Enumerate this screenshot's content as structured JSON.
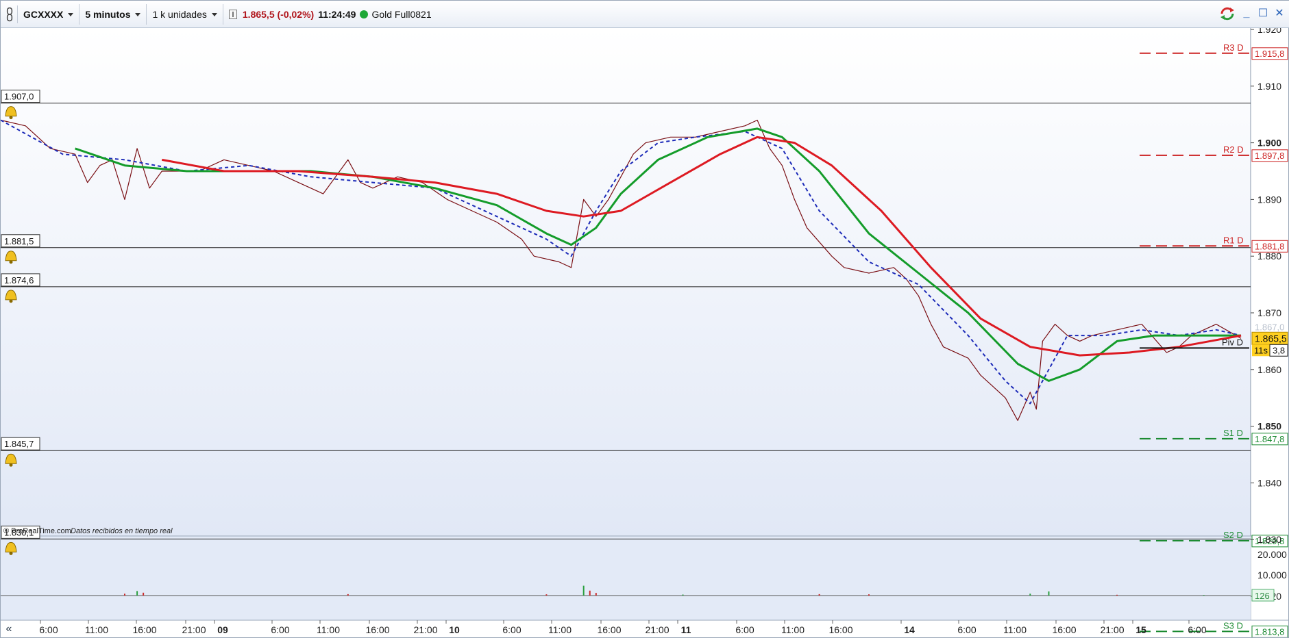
{
  "toolbar": {
    "symbol": "GCXXXX",
    "timeframe": "5 minutos",
    "units": "1 k unidades",
    "price_change": "1.865,5 (-0,02%)",
    "clock": "11:24:49",
    "instrument": "Gold Full0821"
  },
  "colors": {
    "price_line": "#7a0f14",
    "ma_red": "#dd1a22",
    "ma_green": "#149c2a",
    "ma_dashed": "#1c2ab8",
    "resistance": "#cc2222",
    "support": "#1a8a30",
    "price_tag": "#ffd020"
  },
  "horizontal_levels": [
    {
      "label": "1.907,0",
      "value": 1907.0
    },
    {
      "label": "1.881,5",
      "value": 1881.5
    },
    {
      "label": "1.874,6",
      "value": 1874.6
    },
    {
      "label": "1.845,7",
      "value": 1845.7
    },
    {
      "label": "1.830,1",
      "value": 1830.1
    }
  ],
  "pivots": [
    {
      "name": "R3 D",
      "value": 1915.8,
      "label": "1.915,8",
      "kind": "resistance"
    },
    {
      "name": "R2 D",
      "value": 1897.8,
      "label": "1.897,8",
      "kind": "resistance"
    },
    {
      "name": "R1 D",
      "value": 1881.8,
      "label": "1.881,8",
      "kind": "resistance"
    },
    {
      "name": "S1 D",
      "value": 1847.8,
      "label": "1.847,8",
      "kind": "support"
    },
    {
      "name": "S2 D",
      "value": 1829.8,
      "label": "1.829,8",
      "kind": "support"
    },
    {
      "name": "S3 D",
      "value": 1813.8,
      "label": "1.813,8",
      "kind": "support"
    }
  ],
  "pivot_point": {
    "name": "Piv D",
    "value": 1863.8,
    "label": "3,8"
  },
  "current_price": {
    "value": 1865.5,
    "label": "1.865,5"
  },
  "countdown": "11s",
  "faded_price_label": "1.867,0",
  "price_axis": [
    {
      "v": 1920,
      "label": "1.920",
      "bold": false
    },
    {
      "v": 1910,
      "label": "1.910",
      "bold": false
    },
    {
      "v": 1900,
      "label": "1.900",
      "bold": true
    },
    {
      "v": 1890,
      "label": "1.890",
      "bold": false
    },
    {
      "v": 1880,
      "label": "1.880",
      "bold": false
    },
    {
      "v": 1870,
      "label": "1.870",
      "bold": false
    },
    {
      "v": 1860,
      "label": "1.860",
      "bold": false
    },
    {
      "v": 1850,
      "label": "1.850",
      "bold": true
    },
    {
      "v": 1840,
      "label": "1.840",
      "bold": false
    },
    {
      "v": 1830,
      "label": "1.830",
      "bold": false
    },
    {
      "v": 1820,
      "label": "1.820",
      "bold": false
    }
  ],
  "volume_axis": [
    {
      "label": "20.000"
    },
    {
      "label": "10.000"
    }
  ],
  "volume_current": "126",
  "watermark": {
    "brand": "© ProRealTime.com",
    "status": "Datos recibidos en tiempo real"
  },
  "time_axis": [
    "6:00",
    "11:00",
    "16:00",
    "21:00",
    "09",
    "6:00",
    "11:00",
    "16:00",
    "21:00",
    "10",
    "6:00",
    "11:00",
    "16:00",
    "21:00",
    "11",
    "6:00",
    "11:00",
    "16:00",
    "14",
    "6:00",
    "11:00",
    "16:00",
    "21:00",
    "15",
    "6:00"
  ],
  "time_axis_bold": [
    "09",
    "10",
    "11",
    "14",
    "15"
  ],
  "collapse_label": "«",
  "chart_data": {
    "type": "line",
    "ylim": [
      1808,
      1924
    ],
    "x_index_range": [
      0,
      100
    ],
    "day_separators_x": [
      17,
      36,
      55,
      73,
      91
    ],
    "series": [
      {
        "role": "price",
        "points": [
          [
            0,
            1904
          ],
          [
            2,
            1903
          ],
          [
            4,
            1899
          ],
          [
            6,
            1898
          ],
          [
            7,
            1893
          ],
          [
            8,
            1896
          ],
          [
            9,
            1897
          ],
          [
            10,
            1890
          ],
          [
            11,
            1899
          ],
          [
            12,
            1892
          ],
          [
            13,
            1895
          ],
          [
            14,
            1895
          ],
          [
            16,
            1895
          ],
          [
            18,
            1897
          ],
          [
            20,
            1896
          ],
          [
            22,
            1895
          ],
          [
            24,
            1893
          ],
          [
            26,
            1891
          ],
          [
            28,
            1897
          ],
          [
            29,
            1893
          ],
          [
            30,
            1892
          ],
          [
            32,
            1894
          ],
          [
            34,
            1893
          ],
          [
            36,
            1890
          ],
          [
            38,
            1888
          ],
          [
            40,
            1886
          ],
          [
            42,
            1883
          ],
          [
            43,
            1880
          ],
          [
            45,
            1879
          ],
          [
            46,
            1878
          ],
          [
            47,
            1890
          ],
          [
            48,
            1887
          ],
          [
            49,
            1890
          ],
          [
            50,
            1894
          ],
          [
            51,
            1898
          ],
          [
            52,
            1900
          ],
          [
            54,
            1901
          ],
          [
            56,
            1901
          ],
          [
            58,
            1902
          ],
          [
            60,
            1903
          ],
          [
            61,
            1904
          ],
          [
            62,
            1899
          ],
          [
            63,
            1896
          ],
          [
            64,
            1890
          ],
          [
            65,
            1885
          ],
          [
            67,
            1880
          ],
          [
            68,
            1878
          ],
          [
            70,
            1877
          ],
          [
            72,
            1878
          ],
          [
            73,
            1876
          ],
          [
            74,
            1873
          ],
          [
            75,
            1868
          ],
          [
            76,
            1864
          ],
          [
            78,
            1862
          ],
          [
            79,
            1859
          ],
          [
            80,
            1857
          ],
          [
            81,
            1855
          ],
          [
            82,
            1851
          ],
          [
            83,
            1856
          ],
          [
            83.5,
            1853
          ],
          [
            84,
            1865
          ],
          [
            85,
            1868
          ],
          [
            86,
            1866
          ],
          [
            87,
            1865
          ],
          [
            88,
            1866
          ],
          [
            90,
            1867
          ],
          [
            92,
            1868
          ],
          [
            94,
            1863
          ],
          [
            95,
            1864
          ],
          [
            96,
            1866
          ],
          [
            98,
            1868
          ],
          [
            100,
            1865.5
          ]
        ]
      },
      {
        "role": "ma_dashed",
        "points": [
          [
            0,
            1904
          ],
          [
            5,
            1898
          ],
          [
            10,
            1897
          ],
          [
            15,
            1895
          ],
          [
            20,
            1896
          ],
          [
            25,
            1894
          ],
          [
            30,
            1893
          ],
          [
            35,
            1892
          ],
          [
            40,
            1887
          ],
          [
            44,
            1883
          ],
          [
            46,
            1880
          ],
          [
            48,
            1888
          ],
          [
            50,
            1895
          ],
          [
            53,
            1900
          ],
          [
            56,
            1901
          ],
          [
            60,
            1902
          ],
          [
            63,
            1899
          ],
          [
            66,
            1888
          ],
          [
            70,
            1879
          ],
          [
            74,
            1875
          ],
          [
            78,
            1866
          ],
          [
            81,
            1858
          ],
          [
            83,
            1854
          ],
          [
            84.5,
            1860
          ],
          [
            86,
            1866
          ],
          [
            89,
            1866
          ],
          [
            92,
            1867
          ],
          [
            95,
            1866
          ],
          [
            98,
            1867
          ],
          [
            100,
            1866
          ]
        ]
      },
      {
        "role": "ma_green",
        "points": [
          [
            6,
            1899
          ],
          [
            10,
            1896
          ],
          [
            15,
            1895
          ],
          [
            20,
            1895
          ],
          [
            25,
            1895
          ],
          [
            30,
            1894
          ],
          [
            35,
            1892
          ],
          [
            40,
            1889
          ],
          [
            44,
            1884
          ],
          [
            46,
            1882
          ],
          [
            48,
            1885
          ],
          [
            50,
            1891
          ],
          [
            53,
            1897
          ],
          [
            57,
            1901
          ],
          [
            61,
            1902.5
          ],
          [
            63,
            1901
          ],
          [
            66,
            1895
          ],
          [
            70,
            1884
          ],
          [
            74,
            1877
          ],
          [
            78,
            1870
          ],
          [
            82,
            1861
          ],
          [
            84.5,
            1858
          ],
          [
            87,
            1860
          ],
          [
            90,
            1865
          ],
          [
            93,
            1866
          ],
          [
            96,
            1866
          ],
          [
            100,
            1866
          ]
        ]
      },
      {
        "role": "ma_red",
        "points": [
          [
            13,
            1897
          ],
          [
            18,
            1895
          ],
          [
            24,
            1895
          ],
          [
            30,
            1894
          ],
          [
            35,
            1893
          ],
          [
            40,
            1891
          ],
          [
            44,
            1888
          ],
          [
            47,
            1887
          ],
          [
            50,
            1888
          ],
          [
            54,
            1893
          ],
          [
            58,
            1898
          ],
          [
            61,
            1901
          ],
          [
            64,
            1900
          ],
          [
            67,
            1896
          ],
          [
            71,
            1888
          ],
          [
            75,
            1878
          ],
          [
            79,
            1869
          ],
          [
            83,
            1864
          ],
          [
            87,
            1862.5
          ],
          [
            91,
            1863
          ],
          [
            95,
            1864
          ],
          [
            100,
            1866
          ]
        ]
      }
    ],
    "volume": {
      "baseline": 0,
      "spikes": [
        [
          10,
          900
        ],
        [
          11,
          2200
        ],
        [
          11.5,
          1400
        ],
        [
          28,
          700
        ],
        [
          44,
          600
        ],
        [
          47,
          4800
        ],
        [
          47.5,
          2400
        ],
        [
          48,
          1300
        ],
        [
          55,
          500
        ],
        [
          66,
          700
        ],
        [
          70,
          600
        ],
        [
          83,
          900
        ],
        [
          84.5,
          2000
        ],
        [
          90,
          400
        ],
        [
          97,
          300
        ]
      ]
    }
  }
}
